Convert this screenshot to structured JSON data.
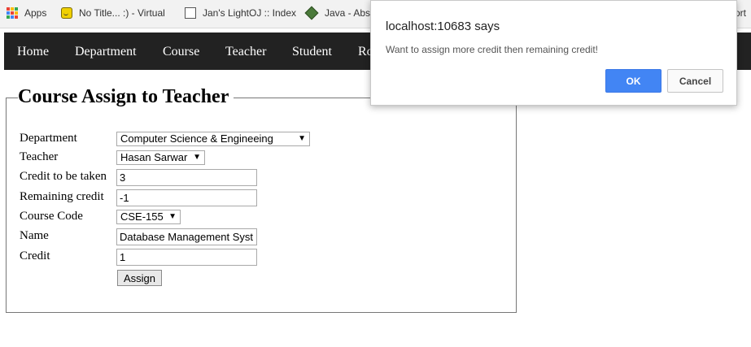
{
  "bookmarks": [
    {
      "label": "Apps",
      "icon": "apps-grid-icon"
    },
    {
      "label": "No Title... :) - Virtual",
      "icon": "smiley-icon"
    },
    {
      "label": "Jan's LightOJ :: Index",
      "icon": "page-icon"
    },
    {
      "label": "Java - Abst",
      "icon": "diamond-icon"
    },
    {
      "label": "ort",
      "icon": ""
    }
  ],
  "nav": {
    "items": [
      "Home",
      "Department",
      "Course",
      "Teacher",
      "Student",
      "Ro"
    ]
  },
  "form": {
    "legend": "Course Assign to Teacher",
    "labels": {
      "department": "Department",
      "teacher": "Teacher",
      "credit_to_be_taken": "Credit to be taken",
      "remaining_credit": "Remaining credit",
      "course_code": "Course Code",
      "name": "Name",
      "credit": "Credit"
    },
    "values": {
      "department": "Computer Science & Engineeing",
      "teacher": "Hasan Sarwar",
      "credit_to_be_taken": "3",
      "remaining_credit": "-1",
      "course_code": "CSE-155",
      "name": "Database Management Syst",
      "credit": "1"
    },
    "assign_label": "Assign"
  },
  "dialog": {
    "title": "localhost:10683 says",
    "message": "Want to assign more credit then remaining credit!",
    "ok_label": "OK",
    "cancel_label": "Cancel"
  },
  "colors": {
    "navbar_bg": "#222222",
    "ok_button": "#4285f4"
  }
}
